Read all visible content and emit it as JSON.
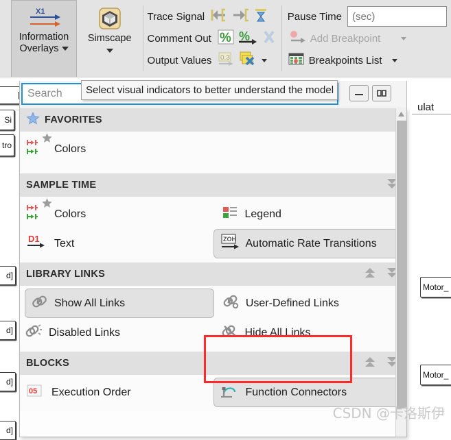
{
  "ribbon": {
    "information_overlays": {
      "label_line1": "Information",
      "label_line2": "Overlays",
      "icon": "x1-signal-arrows-icon"
    },
    "simscape": {
      "label": "Simscape",
      "icon": "simscape-cube-icon"
    },
    "commands": [
      {
        "label": "Trace Signal",
        "icons": [
          "trace-backward-icon",
          "trace-forward-icon",
          "clear-trace-icon"
        ]
      },
      {
        "label": "Comment Out",
        "icons": [
          "comment-out-icon",
          "comment-through-icon",
          "uncomment-icon"
        ]
      },
      {
        "label": "Output Values",
        "icons": [
          "output-value-icon",
          "port-value-labels-icon",
          "output-values-dropdown-icon"
        ]
      }
    ],
    "pause_time": {
      "label": "Pause Time",
      "value": "",
      "placeholder": "(sec)"
    },
    "add_breakpoint": {
      "label": "Add Breakpoint",
      "icon": "add-breakpoint-icon",
      "disabled": true
    },
    "breakpoints_list": {
      "label": "Breakpoints List",
      "icon": "breakpoints-list-icon"
    }
  },
  "tooltip": {
    "text": "Select visual indicators to better understand the model"
  },
  "search": {
    "value": "",
    "placeholder": "Search"
  },
  "panel": {
    "sections": [
      {
        "title": "FAVORITES",
        "icon": "favorites-star-icon",
        "has_collapse_controls": false,
        "items": [
          {
            "label": "Colors",
            "icon": "sample-time-colors-icon",
            "favorited": true,
            "selected": false
          }
        ]
      },
      {
        "title": "SAMPLE TIME",
        "has_collapse_controls": true,
        "controls": [
          "chevrons-down-icon"
        ],
        "items": [
          {
            "label": "Colors",
            "icon": "sample-time-colors-icon",
            "favorited": true,
            "selected": false
          },
          {
            "label": "Legend",
            "icon": "legend-icon",
            "favorited": false,
            "selected": false
          },
          {
            "label": "Text",
            "icon": "sample-time-text-icon",
            "favorited": false,
            "selected": false
          },
          {
            "label": "Automatic Rate Transitions",
            "icon": "zoh-rate-transition-icon",
            "favorited": false,
            "selected": true
          }
        ]
      },
      {
        "title": "LIBRARY LINKS",
        "has_collapse_controls": true,
        "controls": [
          "chevrons-up-icon",
          "chevrons-down-icon"
        ],
        "items": [
          {
            "label": "Show All Links",
            "icon": "link-icon",
            "selected": true
          },
          {
            "label": "User-Defined Links",
            "icon": "user-defined-link-icon",
            "selected": false
          },
          {
            "label": "Disabled Links",
            "icon": "broken-link-icon",
            "selected": false
          },
          {
            "label": "Hide All Links",
            "icon": "hide-links-icon",
            "selected": false,
            "highlighted": true
          }
        ]
      },
      {
        "title": "BLOCKS",
        "has_collapse_controls": true,
        "controls": [
          "chevrons-up-icon",
          "chevrons-down-icon"
        ],
        "items": [
          {
            "label": "Execution Order",
            "icon": "execution-order-icon",
            "selected": false
          },
          {
            "label": "Function Connectors",
            "icon": "function-connectors-icon",
            "selected": true
          }
        ]
      }
    ]
  },
  "background": {
    "left_labels": [
      "d]",
      "d]",
      "d]",
      "d]"
    ],
    "right_labels": [
      "Motor_",
      "Motor_"
    ]
  },
  "watermark": {
    "text": "CSDN @卡洛斯伊"
  },
  "colors": {
    "accent_blue": "#1e90e0",
    "highlight_red": "#ff2b2b",
    "section_header_bg": "#e0e0e0",
    "ribbon_bg": "#e4e4e4",
    "panel_bg": "#fdfdfd"
  }
}
